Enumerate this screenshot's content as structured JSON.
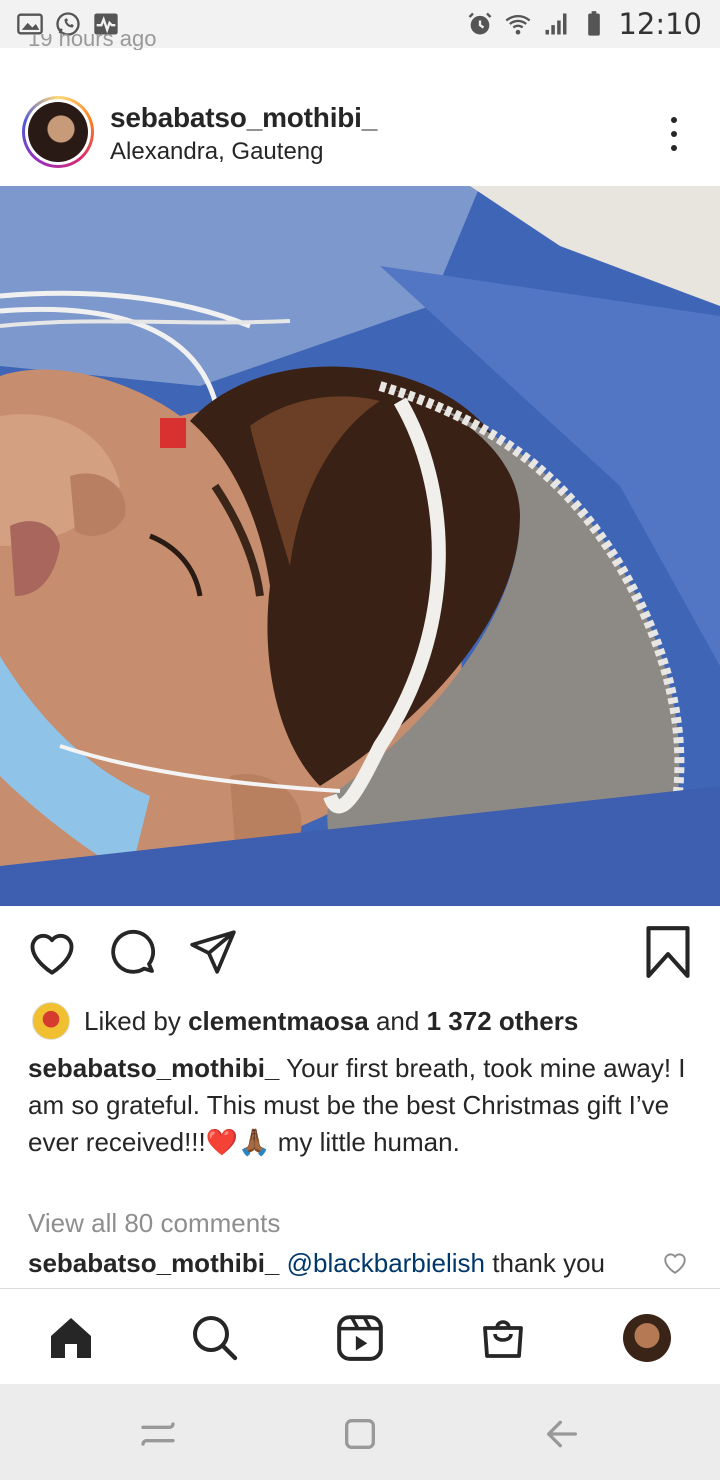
{
  "status_bar": {
    "time": "12:10",
    "left_icons": [
      "gallery-icon",
      "whatsapp-icon",
      "activity-icon"
    ],
    "right_icons": [
      "alarm-icon",
      "wifi-icon",
      "signal-icon",
      "battery-icon"
    ]
  },
  "prev_post": {
    "time_cutoff": "19 hours ago"
  },
  "post": {
    "username": "sebabatso_mothibi_",
    "location": "Alexandra, Gauteng",
    "likes": {
      "prefix": "Liked by",
      "liker": "clementmaosa",
      "joiner": "and",
      "others": "1 372 others"
    },
    "caption": {
      "user": "sebabatso_mothibi_",
      "text_1": "Your first breath, took mine away! I am so grateful. This must be the best Christmas gift I’ve ever received!!!",
      "emoji": "❤️🙏🏾",
      "text_2": " my little human."
    },
    "view_comments": "View all 80 comments",
    "comment": {
      "user": "sebabatso_mothibi_",
      "mention": "@blackbarbielish",
      "text": " thank you"
    }
  },
  "bottom_nav": [
    "home-icon",
    "search-icon",
    "reels-icon",
    "shop-icon",
    "profile-avatar"
  ],
  "system_nav": [
    "recents-button",
    "home-button",
    "back-button"
  ]
}
